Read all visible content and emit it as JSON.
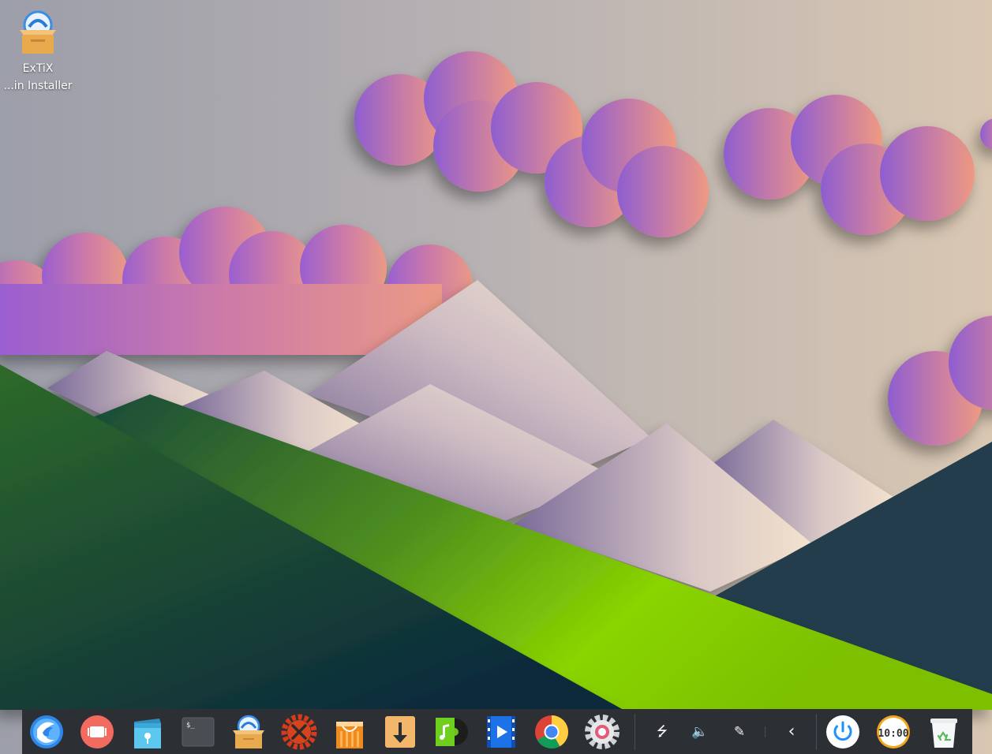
{
  "desktop": {
    "icon": {
      "icon_name": "package-box-icon",
      "line1": "ExTiX",
      "line2": "...in Installer"
    }
  },
  "dock": {
    "apps": [
      {
        "name": "launcher-icon"
      },
      {
        "name": "multitasking-view-icon"
      },
      {
        "name": "file-manager-icon"
      },
      {
        "name": "terminal-icon",
        "label": "$_"
      },
      {
        "name": "installer-box-icon"
      },
      {
        "name": "system-tools-icon"
      },
      {
        "name": "app-store-icon"
      },
      {
        "name": "download-manager-icon"
      },
      {
        "name": "music-player-icon"
      },
      {
        "name": "video-player-icon"
      },
      {
        "name": "chrome-browser-icon"
      },
      {
        "name": "settings-icon"
      }
    ],
    "tray": [
      {
        "name": "usb-icon",
        "glyph": "⭍"
      },
      {
        "name": "volume-icon",
        "glyph": "🔈"
      },
      {
        "name": "pen-icon",
        "glyph": "✎"
      },
      {
        "name": "expand-tray-icon",
        "glyph": "‹"
      }
    ],
    "right": [
      {
        "name": "power-icon"
      },
      {
        "name": "clock-icon",
        "label": "10:00"
      },
      {
        "name": "trash-icon"
      }
    ],
    "colors": {
      "background": "#2c2f33",
      "accent": "#1e90ff"
    }
  }
}
